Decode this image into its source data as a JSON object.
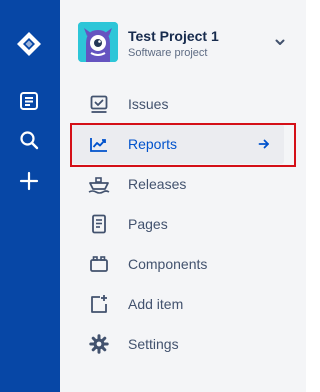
{
  "colors": {
    "global_nav_bg": "#0747a6",
    "sidebar_bg": "#f4f5f7",
    "active_text": "#0052cc",
    "item_text": "#42526e",
    "highlight_border": "#d40f17"
  },
  "global_nav": {
    "items": [
      {
        "icon": "jira-logo-icon"
      },
      {
        "icon": "document-icon"
      },
      {
        "icon": "search-icon"
      },
      {
        "icon": "plus-icon"
      }
    ]
  },
  "project": {
    "name": "Test Project 1",
    "type": "Software project",
    "avatar_icon": "monster-avatar-icon",
    "expand_icon": "chevron-down-icon"
  },
  "sidebar": {
    "items": [
      {
        "label": "Issues",
        "icon": "issues-icon",
        "active": false
      },
      {
        "label": "Reports",
        "icon": "reports-icon",
        "active": true
      },
      {
        "label": "Releases",
        "icon": "releases-icon",
        "active": false
      },
      {
        "label": "Pages",
        "icon": "pages-icon",
        "active": false
      },
      {
        "label": "Components",
        "icon": "components-icon",
        "active": false
      },
      {
        "label": "Add item",
        "icon": "add-item-icon",
        "active": false
      },
      {
        "label": "Settings",
        "icon": "settings-icon",
        "active": false
      }
    ]
  }
}
